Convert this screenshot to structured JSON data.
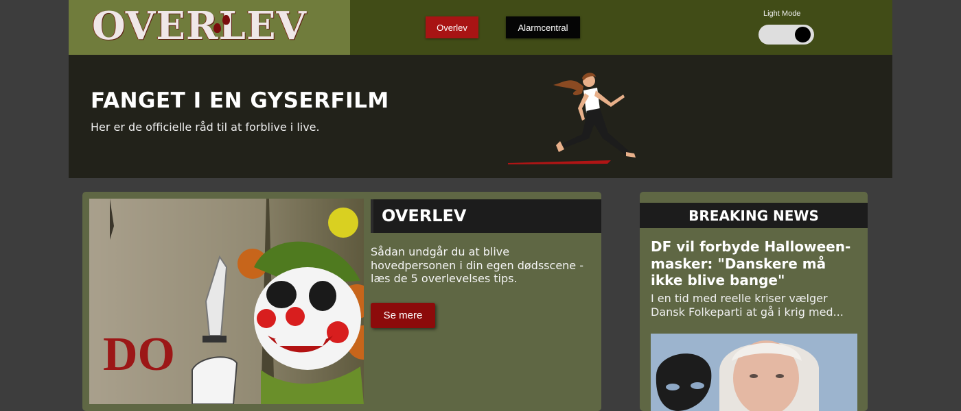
{
  "header": {
    "logo_text": "OVERLEV",
    "nav": [
      {
        "label": "Overlev"
      },
      {
        "label": "Alarmcentral"
      }
    ],
    "theme_toggle_label": "Light Mode",
    "theme_toggle_on": true
  },
  "hero": {
    "title": "FANGET I EN GYSERFILM",
    "subtitle": "Her er de officielle råd til at forblive i live."
  },
  "main_card": {
    "image_text": "DO",
    "heading": "OVERLEV",
    "text": "Sådan undgår du at blive hovedpersonen i din egen dødsscene - læs de 5 overlevelses tips.",
    "button_label": "Se mere"
  },
  "news": {
    "heading": "BREAKING NEWS",
    "title": "DF vil forbyde Halloween-masker: \"Danskere må ikke blive bange\"",
    "excerpt": "I en tid med reelle kriser vælger Dansk Folkeparti at gå i krig med..."
  },
  "colors": {
    "page_bg": "#3d3d3d",
    "header_bg": "#414c17",
    "logo_bg": "#707c3c",
    "hero_bg": "#22221a",
    "card_bg": "#5f6744",
    "accent_red": "#a81414",
    "dark": "#1c1c1c"
  },
  "icons": [
    "blood-drop-icon",
    "toggle-knob-icon"
  ]
}
